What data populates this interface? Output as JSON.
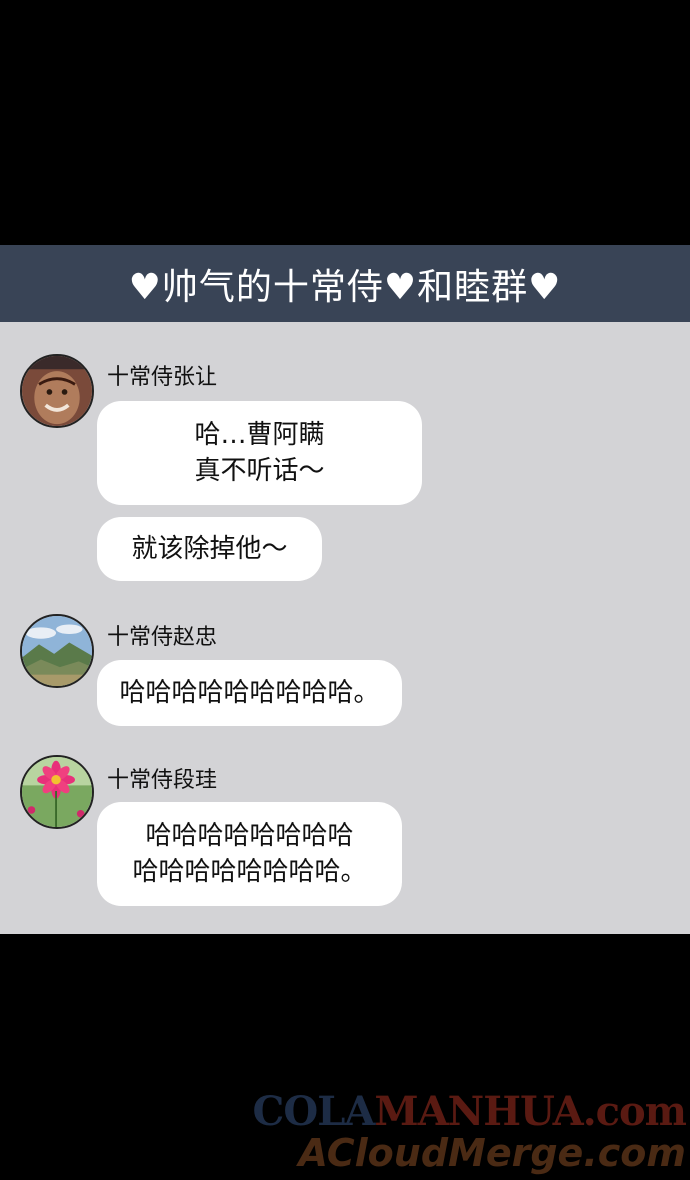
{
  "header": {
    "title": "♥帅气的十常侍♥和睦群♥"
  },
  "messages": [
    {
      "sender": "十常侍张让",
      "avatar": "face-avatar",
      "bubbles": [
        {
          "lines": [
            "哈…曹阿瞒",
            "真不听话～"
          ]
        },
        {
          "lines": [
            "就该除掉他～"
          ]
        }
      ]
    },
    {
      "sender": "十常侍赵忠",
      "avatar": "mountain-avatar",
      "bubbles": [
        {
          "lines": [
            "哈哈哈哈哈哈哈哈哈。"
          ]
        }
      ]
    },
    {
      "sender": "十常侍段珪",
      "avatar": "flower-avatar",
      "bubbles": [
        {
          "lines": [
            "哈哈哈哈哈哈哈哈",
            "哈哈哈哈哈哈哈哈。"
          ]
        }
      ]
    }
  ],
  "watermark": {
    "line1_a": "COLA",
    "line1_b": "MANHUA.com",
    "line2": "ACloudMerge.com"
  },
  "colors": {
    "header_bg": "#394456",
    "chat_bg": "#d3d3d6",
    "bubble": "#ffffff"
  }
}
